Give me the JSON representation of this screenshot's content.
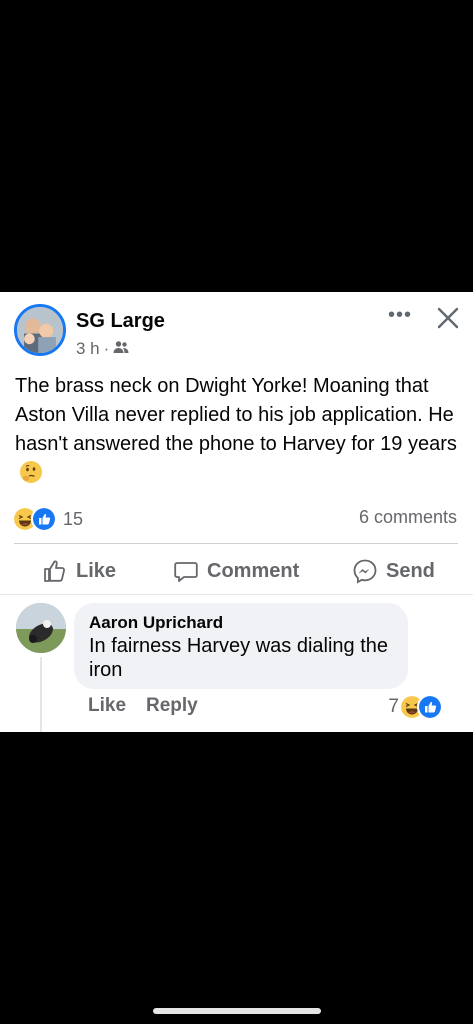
{
  "post": {
    "author": "SG Large",
    "time": "3 h",
    "separator": "·",
    "audience_icon": "friends-icon",
    "text": "The brass neck on Dwight Yorke! Moaning that Aston Villa never replied to his job application. He hasn't answered the phone to Harvey for 19 years",
    "reaction_count": "15",
    "comments_count": "6 comments"
  },
  "actions": {
    "like": "Like",
    "comment": "Comment",
    "send": "Send"
  },
  "comment": {
    "author": "Aaron Uprichard",
    "text": "In fairness Harvey was dialing the iron",
    "like": "Like",
    "reply": "Reply",
    "reaction_count": "7"
  },
  "colors": {
    "brand_blue": "#1877f2",
    "secondary_text": "#65676b",
    "bubble_bg": "#f0f2f5"
  }
}
